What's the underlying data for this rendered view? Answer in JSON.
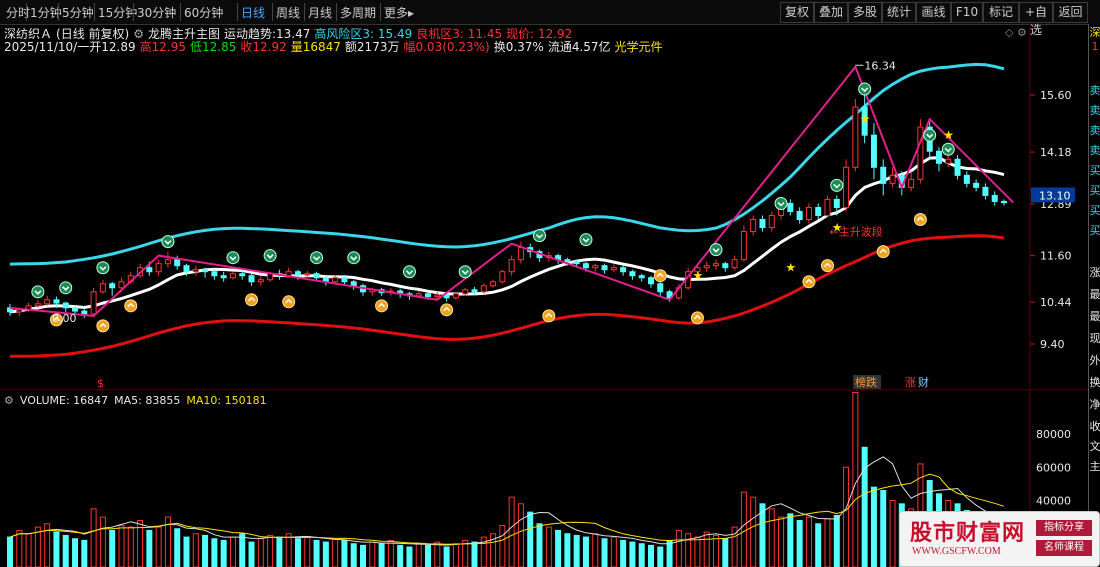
{
  "toolbar": {
    "left": [
      "分时",
      "1分钟",
      "5分钟",
      "15分钟",
      "30分钟",
      "60分钟",
      "日线",
      "周线",
      "月线",
      "多周期",
      "更多▸"
    ],
    "active": "日线",
    "right": [
      "复权",
      "叠加",
      "多股",
      "统计",
      "画线",
      "F10",
      "标记",
      "+自选",
      "返回"
    ]
  },
  "info": {
    "stock": "深纺织Ａ",
    "mode": "(日线 前复权)",
    "indicator": "龙腾主升主图",
    "trend_label": "运动趋势:",
    "trend_value": "13.47",
    "risk": "高风险区3: 15.49",
    "opp": "良机区3: 11.45",
    "price": "现价: 12.92",
    "date": "2025/11/10/一",
    "open_label": "开",
    "open": "12.89",
    "high_label": "高",
    "high": "12.95",
    "low_label": "低",
    "low": "12.85",
    "close_label": "收",
    "close": "12.92",
    "vol_label": "量",
    "vol": "16847",
    "amount": "额2173万",
    "range_label": "幅",
    "range": "0.03(0.23%)",
    "turnover": "换0.37%",
    "float": "流通4.57亿",
    "sector": "光学元件"
  },
  "price_axis": {
    "ticks": [
      "15.60",
      "14.18",
      "12.89",
      "11.60",
      "10.44",
      "9.40"
    ],
    "current": "13.10"
  },
  "annotations": {
    "peak": "16.34",
    "low": "0.00",
    "wave": "←主升波段",
    "s_mark": "$",
    "tag1": "榜跌",
    "tag2_a": "涨",
    "tag2_b": "财"
  },
  "volume": {
    "label": "VOLUME: 16847",
    "ma5": "MA5: 83855",
    "ma10": "MA10: 150181",
    "ticks": [
      "80000",
      "60000",
      "40000"
    ]
  },
  "right_side": [
    "深",
    "1",
    "卖",
    "卖",
    "卖",
    "卖",
    "买",
    "买",
    "买",
    "买",
    "涨",
    "最",
    "最",
    "现",
    "外",
    "换",
    "净",
    "收",
    "文",
    "主"
  ],
  "watermark": {
    "name": "股市财富网",
    "url": "WWW.GSCFW.COM",
    "tag1": "指标分享",
    "tag2": "名师课程"
  },
  "colors": {
    "up": "#ff3232",
    "down": "#54ffff",
    "ma_white": "#ffffff",
    "band_cyan": "#3ad6ea",
    "band_red": "#e01010",
    "zigzag": "#e0208c",
    "yellow": "#ffe000"
  },
  "chart_data": {
    "type": "candlestick",
    "series": [
      {
        "name": "OHLC",
        "values": [
          [
            10.3,
            10.2,
            10.4,
            10.1
          ],
          [
            10.2,
            10.25,
            10.3,
            10.1
          ],
          [
            10.25,
            10.35,
            10.42,
            10.2
          ],
          [
            10.35,
            10.4,
            10.5,
            10.3
          ],
          [
            10.4,
            10.5,
            10.6,
            10.35
          ],
          [
            10.5,
            10.42,
            10.58,
            10.3
          ],
          [
            10.42,
            10.3,
            10.45,
            10.2
          ],
          [
            10.3,
            10.22,
            10.35,
            10.15
          ],
          [
            10.22,
            10.15,
            10.3,
            10.05
          ],
          [
            10.15,
            10.7,
            10.8,
            10.1
          ],
          [
            10.7,
            10.9,
            11.0,
            10.65
          ],
          [
            10.9,
            10.8,
            10.95,
            10.6
          ],
          [
            10.8,
            10.95,
            11.05,
            10.7
          ],
          [
            10.95,
            11.1,
            11.2,
            10.9
          ],
          [
            11.1,
            11.3,
            11.4,
            11.05
          ],
          [
            11.3,
            11.2,
            11.45,
            11.1
          ],
          [
            11.2,
            11.4,
            11.5,
            11.1
          ],
          [
            11.4,
            11.5,
            11.7,
            11.3
          ],
          [
            11.5,
            11.35,
            11.6,
            11.25
          ],
          [
            11.35,
            11.2,
            11.4,
            11.1
          ],
          [
            11.2,
            11.25,
            11.35,
            11.1
          ],
          [
            11.25,
            11.2,
            11.3,
            11.05
          ],
          [
            11.2,
            11.1,
            11.25,
            11.0
          ],
          [
            11.1,
            11.05,
            11.2,
            10.95
          ],
          [
            11.05,
            11.15,
            11.2,
            11.0
          ],
          [
            11.15,
            11.1,
            11.25,
            11.0
          ],
          [
            11.1,
            10.95,
            11.15,
            10.85
          ],
          [
            10.95,
            11.0,
            11.1,
            10.85
          ],
          [
            11.0,
            11.15,
            11.2,
            10.95
          ],
          [
            11.15,
            11.1,
            11.25,
            11.0
          ],
          [
            11.1,
            11.2,
            11.3,
            11.05
          ],
          [
            11.2,
            11.12,
            11.25,
            11.0
          ],
          [
            11.12,
            11.15,
            11.22,
            11.05
          ],
          [
            11.15,
            11.05,
            11.2,
            10.95
          ],
          [
            11.05,
            10.95,
            11.1,
            10.85
          ],
          [
            10.95,
            11.05,
            11.1,
            10.9
          ],
          [
            11.05,
            10.95,
            11.12,
            10.85
          ],
          [
            10.95,
            10.85,
            11.0,
            10.75
          ],
          [
            10.85,
            10.7,
            10.9,
            10.6
          ],
          [
            10.7,
            10.75,
            10.8,
            10.6
          ],
          [
            10.75,
            10.68,
            10.8,
            10.6
          ],
          [
            10.68,
            10.72,
            10.8,
            10.6
          ],
          [
            10.72,
            10.65,
            10.78,
            10.55
          ],
          [
            10.65,
            10.6,
            10.7,
            10.5
          ],
          [
            10.6,
            10.65,
            10.72,
            10.55
          ],
          [
            10.65,
            10.58,
            10.7,
            10.5
          ],
          [
            10.58,
            10.62,
            10.7,
            10.5
          ],
          [
            10.62,
            10.55,
            10.66,
            10.45
          ],
          [
            10.55,
            10.65,
            10.7,
            10.5
          ],
          [
            10.65,
            10.75,
            10.8,
            10.6
          ],
          [
            10.75,
            10.7,
            10.82,
            10.62
          ],
          [
            10.7,
            10.85,
            10.9,
            10.65
          ],
          [
            10.85,
            10.95,
            11.0,
            10.8
          ],
          [
            10.95,
            11.2,
            11.25,
            10.9
          ],
          [
            11.2,
            11.5,
            11.6,
            11.1
          ],
          [
            11.5,
            11.8,
            11.95,
            11.4
          ],
          [
            11.8,
            11.7,
            11.9,
            11.55
          ],
          [
            11.7,
            11.55,
            11.75,
            11.45
          ],
          [
            11.55,
            11.6,
            11.7,
            11.45
          ],
          [
            11.6,
            11.5,
            11.65,
            11.4
          ],
          [
            11.5,
            11.45,
            11.55,
            11.35
          ],
          [
            11.45,
            11.4,
            11.5,
            11.3
          ],
          [
            11.4,
            11.3,
            11.45,
            11.2
          ],
          [
            11.3,
            11.35,
            11.4,
            11.2
          ],
          [
            11.35,
            11.25,
            11.4,
            11.15
          ],
          [
            11.25,
            11.3,
            11.38,
            11.2
          ],
          [
            11.3,
            11.2,
            11.35,
            11.1
          ],
          [
            11.2,
            11.1,
            11.25,
            11.0
          ],
          [
            11.1,
            11.05,
            11.15,
            10.95
          ],
          [
            11.05,
            10.9,
            11.1,
            10.8
          ],
          [
            10.9,
            10.7,
            10.95,
            10.6
          ],
          [
            10.7,
            10.55,
            10.75,
            10.45
          ],
          [
            10.55,
            10.8,
            10.9,
            10.5
          ],
          [
            10.8,
            11.2,
            11.3,
            10.75
          ],
          [
            11.2,
            11.3,
            11.4,
            11.1
          ],
          [
            11.3,
            11.35,
            11.45,
            11.2
          ],
          [
            11.35,
            11.4,
            11.5,
            11.25
          ],
          [
            11.4,
            11.3,
            11.45,
            11.2
          ],
          [
            11.3,
            11.5,
            11.6,
            11.25
          ],
          [
            11.5,
            12.2,
            12.35,
            11.45
          ],
          [
            12.2,
            12.5,
            12.6,
            12.1
          ],
          [
            12.5,
            12.3,
            12.6,
            12.2
          ],
          [
            12.3,
            12.6,
            12.7,
            12.2
          ],
          [
            12.6,
            12.9,
            13.0,
            12.5
          ],
          [
            12.9,
            12.7,
            13.0,
            12.6
          ],
          [
            12.7,
            12.5,
            12.8,
            12.4
          ],
          [
            12.5,
            12.8,
            12.9,
            12.4
          ],
          [
            12.8,
            12.6,
            12.9,
            12.5
          ],
          [
            12.6,
            13.0,
            13.1,
            12.55
          ],
          [
            13.0,
            12.8,
            13.1,
            12.6
          ],
          [
            12.8,
            13.8,
            14.0,
            12.7
          ],
          [
            13.8,
            15.3,
            15.5,
            13.7
          ],
          [
            15.3,
            14.6,
            15.6,
            14.4
          ],
          [
            14.6,
            13.8,
            14.9,
            13.5
          ],
          [
            13.8,
            13.4,
            14.0,
            13.1
          ],
          [
            13.4,
            13.6,
            13.8,
            13.3
          ],
          [
            13.6,
            13.3,
            13.7,
            13.1
          ],
          [
            13.3,
            13.5,
            13.7,
            13.2
          ],
          [
            13.5,
            14.8,
            15.0,
            13.4
          ],
          [
            14.8,
            14.2,
            15.0,
            14.0
          ],
          [
            14.2,
            13.9,
            14.3,
            13.7
          ],
          [
            13.9,
            14.0,
            14.1,
            13.8
          ],
          [
            14.0,
            13.6,
            14.1,
            13.5
          ],
          [
            13.6,
            13.4,
            13.7,
            13.3
          ],
          [
            13.4,
            13.3,
            13.5,
            13.2
          ],
          [
            13.3,
            13.1,
            13.4,
            13.0
          ],
          [
            13.1,
            12.95,
            13.2,
            12.85
          ],
          [
            12.95,
            12.92,
            13.0,
            12.85
          ]
        ]
      },
      {
        "name": "VOLUME",
        "values": [
          18,
          22,
          20,
          24,
          26,
          21,
          19,
          17,
          16,
          35,
          30,
          22,
          25,
          24,
          28,
          22,
          24,
          30,
          23,
          18,
          20,
          19,
          17,
          16,
          18,
          20,
          15,
          17,
          19,
          18,
          20,
          17,
          18,
          16,
          15,
          17,
          16,
          14,
          13,
          15,
          14,
          16,
          13,
          12,
          14,
          13,
          15,
          12,
          14,
          16,
          15,
          18,
          20,
          25,
          42,
          38,
          33,
          26,
          24,
          22,
          20,
          19,
          18,
          20,
          17,
          18,
          16,
          15,
          14,
          13,
          12,
          16,
          22,
          20,
          18,
          21,
          19,
          17,
          24,
          45,
          42,
          38,
          35,
          30,
          32,
          28,
          30,
          26,
          29,
          31,
          60,
          105,
          72,
          48,
          46,
          40,
          38,
          35,
          62,
          52,
          44,
          40,
          38,
          34,
          30,
          26,
          22,
          17
        ]
      }
    ],
    "yaxis_ticks": [
      15.6,
      14.18,
      12.89,
      11.6,
      10.44,
      9.4
    ],
    "volume_ticks": [
      80000,
      60000,
      40000
    ]
  }
}
